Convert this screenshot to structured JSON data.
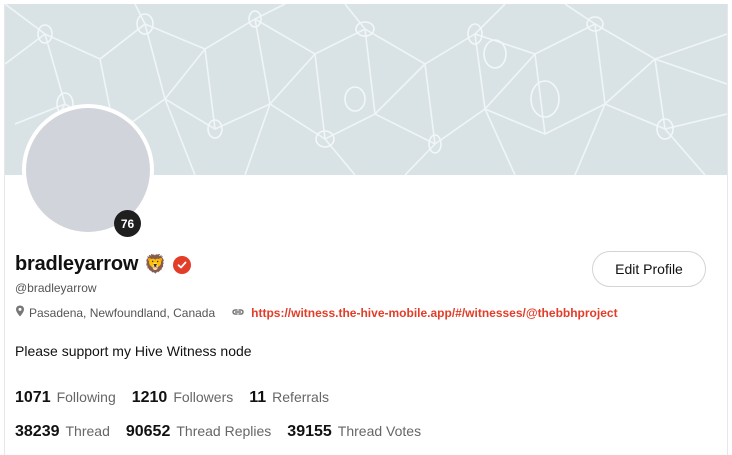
{
  "profile": {
    "display_name": "bradleyarrow",
    "badge_emoji": "🦁",
    "handle": "@bradleyarrow",
    "level": "76",
    "location": "Pasadena, Newfoundland, Canada",
    "website": "https://witness.the-hive-mobile.app/#/witnesses/@thebbhproject",
    "bio": "Please support my Hive Witness node",
    "edit_label": "Edit Profile"
  },
  "stats": {
    "following": {
      "value": "1071",
      "label": "Following"
    },
    "followers": {
      "value": "1210",
      "label": "Followers"
    },
    "referrals": {
      "value": "11",
      "label": "Referrals"
    },
    "thread": {
      "value": "38239",
      "label": "Thread"
    },
    "thread_replies": {
      "value": "90652",
      "label": "Thread Replies"
    },
    "thread_votes": {
      "value": "39155",
      "label": "Thread Votes"
    }
  },
  "colors": {
    "accent": "#e23d28",
    "banner": "#d9e3e5",
    "avatar_placeholder": "#d2d4db"
  },
  "icons": {
    "location": "map-pin-icon",
    "website": "link-icon",
    "verified": "verified-check-icon"
  }
}
